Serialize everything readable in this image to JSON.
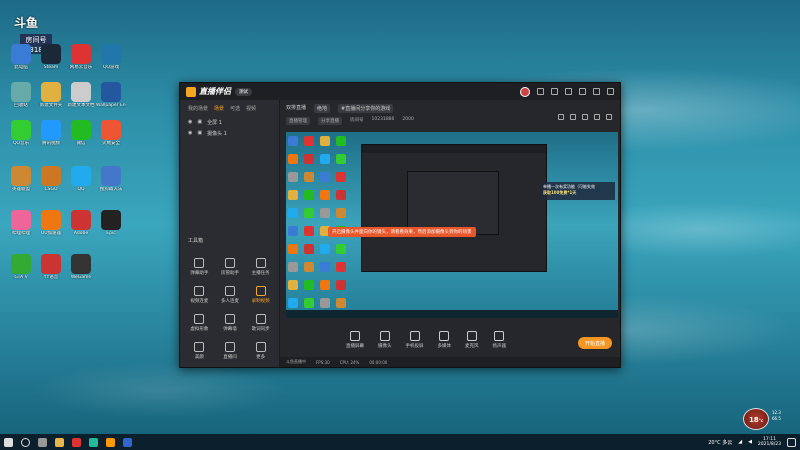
{
  "watermark": {
    "top": "斗鱼",
    "mid": "房间号",
    "num": "10231886"
  },
  "desktop_icons": [
    {
      "label": "此电脑",
      "color": "#3a7bd5"
    },
    {
      "label": "Steam",
      "color": "#1b2838"
    },
    {
      "label": "网易云音乐",
      "color": "#d33"
    },
    {
      "label": "QQ游戏",
      "color": "#27a"
    },
    {
      "label": "回收站",
      "color": "#6aa"
    },
    {
      "label": "新建文件夹",
      "color": "#e0b040"
    },
    {
      "label": "新建文本文档",
      "color": "#ccc"
    },
    {
      "label": "Wallpaper Engine",
      "color": "#2457a0"
    },
    {
      "label": "QQ音乐",
      "color": "#3c3"
    },
    {
      "label": "腾讯视频",
      "color": "#29f"
    },
    {
      "label": "微信",
      "color": "#2b2"
    },
    {
      "label": "火绒安全",
      "color": "#e53"
    },
    {
      "label": "英雄联盟",
      "color": "#c83"
    },
    {
      "label": "CSGO",
      "color": "#c72"
    },
    {
      "label": "QQ",
      "color": "#2ae"
    },
    {
      "label": "搜狗输入法",
      "color": "#47c"
    },
    {
      "label": "哔哩哔哩",
      "color": "#e69"
    },
    {
      "label": "UU加速器",
      "color": "#e71"
    },
    {
      "label": "Adobe",
      "color": "#c33"
    },
    {
      "label": "Epic",
      "color": "#222"
    },
    {
      "label": "GTA V",
      "color": "#3a3"
    },
    {
      "label": "YY语音",
      "color": "#c33"
    },
    {
      "label": "WeGame",
      "color": "#333"
    }
  ],
  "app": {
    "logo": "直播伴侣",
    "version": "测试",
    "tabs": [
      "我的场景",
      "场景",
      "可选",
      "视频"
    ],
    "sources": [
      {
        "name": "全屏 1"
      },
      {
        "name": "摄像头 1"
      }
    ],
    "tools_title": "工具箱",
    "tools": [
      {
        "label": "弹幕助手"
      },
      {
        "label": "房管助手"
      },
      {
        "label": "主播任务"
      },
      {
        "label": "视频连麦"
      },
      {
        "label": "多人连麦"
      },
      {
        "label": "录制视频"
      },
      {
        "label": "虚拟形象"
      },
      {
        "label": "弹幕墙"
      },
      {
        "label": "歌词同步"
      },
      {
        "label": "美颜"
      },
      {
        "label": "直播间"
      },
      {
        "label": "更多"
      }
    ],
    "room_title": "双排直播",
    "room_category": "绝地",
    "room_notice": "#直播间分享你的游戏",
    "btn_room": "直播管理",
    "btn_share": "分享直播",
    "room_label": "房间号",
    "room_id": "10231886",
    "level": "2000",
    "notice_line1": "单播一次有奖功能（可能失效",
    "notice_line2": "获取100免费*1天",
    "banner": "开启摄像头并面向你的镜头，请看看效果，然后添加摄像头到你的场景",
    "bottom_actions": [
      {
        "label": "直播屏幕"
      },
      {
        "label": "摄像头"
      },
      {
        "label": "手机投屏"
      },
      {
        "label": "多媒体"
      },
      {
        "label": "麦克风"
      },
      {
        "label": "扬声器"
      }
    ],
    "go_live": "开始直播",
    "status": [
      "斗鱼直播中",
      "FPS:30",
      "CPU: 24%",
      "00:00:00"
    ]
  },
  "weather_badge": {
    "num": "18",
    "unit": "°c",
    "up": "12.3",
    "down": "66.5"
  },
  "taskbar": {
    "weather": "20°C 多云",
    "time": "17:11",
    "date": "2021/8/23"
  }
}
